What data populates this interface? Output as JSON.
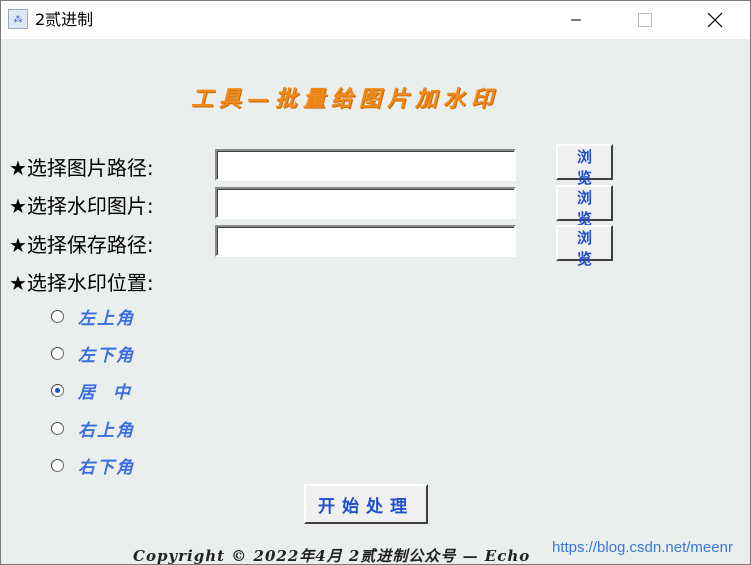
{
  "window": {
    "title": "2贰进制",
    "icon": "app-icon"
  },
  "banner": "工具—批量给图片加水印",
  "rows": [
    {
      "label": "★选择图片路径:",
      "value": "",
      "button": "浏 览"
    },
    {
      "label": "★选择水印图片:",
      "value": "",
      "button": "浏 览"
    },
    {
      "label": "★选择保存路径:",
      "value": "",
      "button": "浏 览"
    }
  ],
  "position_label": "★选择水印位置:",
  "positions": [
    {
      "label": "左上角",
      "selected": false
    },
    {
      "label": "左下角",
      "selected": false
    },
    {
      "label": "居  中",
      "selected": true
    },
    {
      "label": "右上角",
      "selected": false
    },
    {
      "label": "右下角",
      "selected": false
    }
  ],
  "start_button": "开始处理",
  "footer": "Copyright © 2022年4月  2贰进制公众号 — Echo",
  "watermark": "https://blog.csdn.net/meenr",
  "colors": {
    "banner": "#f08a1a",
    "accent": "#1e4fd0",
    "radio_text": "#3b6fe0",
    "background": "#eaeeec"
  }
}
